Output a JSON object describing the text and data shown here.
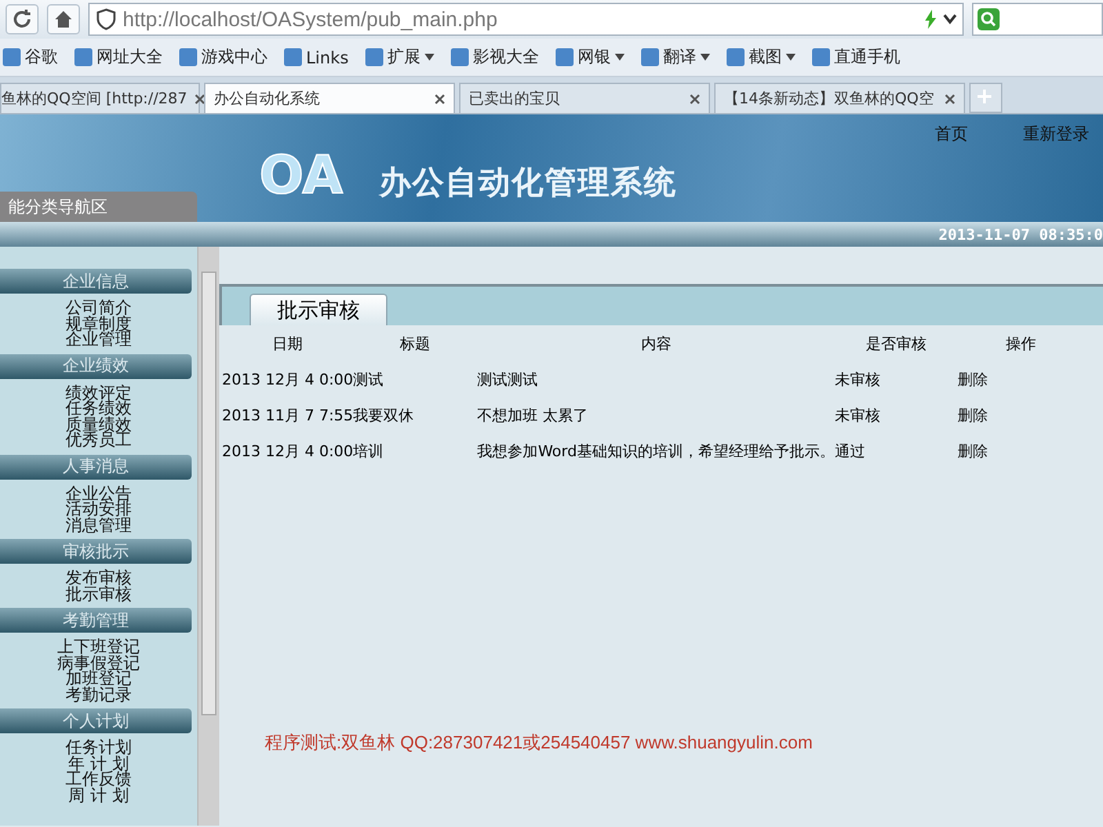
{
  "browser": {
    "url": "http://localhost/OASystem/pub_main.php",
    "bookmarks": [
      {
        "label": "谷歌",
        "has_menu": false
      },
      {
        "label": "网址大全",
        "has_menu": false
      },
      {
        "label": "游戏中心",
        "has_menu": false
      },
      {
        "label": "Links",
        "has_menu": false
      },
      {
        "label": "扩展",
        "has_menu": true
      },
      {
        "label": "影视大全",
        "has_menu": false
      },
      {
        "label": "网银",
        "has_menu": true
      },
      {
        "label": "翻译",
        "has_menu": true
      },
      {
        "label": "截图",
        "has_menu": true
      },
      {
        "label": "直通手机",
        "has_menu": false
      }
    ],
    "tabs": [
      {
        "title": "鱼林的QQ空间 [http://287",
        "selected": false
      },
      {
        "title": "办公自动化系统",
        "selected": true
      },
      {
        "title": "已卖出的宝贝",
        "selected": false
      },
      {
        "title": "【14条新动态】双鱼林的QQ空",
        "selected": false
      }
    ]
  },
  "header": {
    "logo": "OA",
    "title": "办公自动化管理系统",
    "nav": [
      "首页",
      "重新登录"
    ],
    "sidebar_title": "能分类导航区",
    "datetime": "2013-11-07 08:35:0"
  },
  "sidebar": {
    "sections": [
      {
        "title": "企业信息",
        "items": [
          "公司简介",
          "规章制度",
          "企业管理"
        ]
      },
      {
        "title": "企业绩效",
        "items": [
          "绩效评定",
          "任务绩效",
          "质量绩效",
          "优秀员工"
        ]
      },
      {
        "title": "人事消息",
        "items": [
          "企业公告",
          "活动安排",
          "消息管理"
        ]
      },
      {
        "title": "审核批示",
        "items": [
          "发布审核",
          "批示审核"
        ]
      },
      {
        "title": "考勤管理",
        "items": [
          "上下班登记",
          "病事假登记",
          "加班登记",
          "考勤记录"
        ]
      },
      {
        "title": "个人计划",
        "items": [
          "任务计划",
          "年 计 划",
          "工作反馈",
          "周 计 划"
        ]
      }
    ]
  },
  "panel": {
    "tab": "批示审核",
    "table": {
      "columns": [
        "日期",
        "标题",
        "内容",
        "是否审核",
        "操作"
      ],
      "rows": [
        [
          "2013 12月 4 0:00",
          "测试",
          "测试测试",
          "未审核",
          "删除"
        ],
        [
          "2013 11月 7 7:55",
          "我要双休",
          "不想加班 太累了",
          "未审核",
          "删除"
        ],
        [
          "2013 12月 4 0:00",
          "培训",
          "我想参加Word基础知识的培训，希望经理给予批示。",
          "通过",
          "删除"
        ]
      ]
    }
  },
  "footer_note": "程序测试:双鱼林 QQ:287307421或254540457 www.shuangyulin.com"
}
